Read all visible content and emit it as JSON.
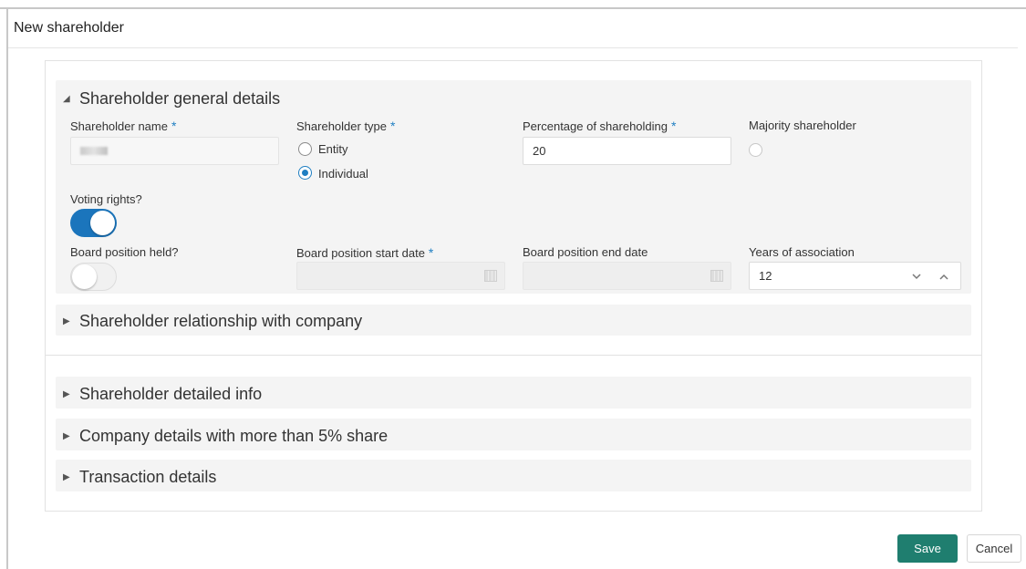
{
  "window": {
    "title": "New shareholder"
  },
  "general_details": {
    "heading": "Shareholder general details",
    "shareholder_name": {
      "label": "Shareholder name",
      "required_mark": "*"
    },
    "shareholder_type": {
      "label": "Shareholder type",
      "required_mark": "*",
      "options": [
        "Entity",
        "Individual"
      ],
      "selected": "Individual"
    },
    "percentage": {
      "label": "Percentage of shareholding",
      "required_mark": "*",
      "value": "20"
    },
    "majority": {
      "label": "Majority shareholder"
    },
    "voting_rights": {
      "label": "Voting rights?",
      "on": true
    },
    "board_position_held": {
      "label": "Board position held?",
      "on": false
    },
    "board_start": {
      "label": "Board position start date",
      "required_mark": "*"
    },
    "board_end": {
      "label": "Board position end date"
    },
    "years_association": {
      "label": "Years of association",
      "value": "12"
    }
  },
  "sections": {
    "relationship": "Shareholder relationship with company",
    "detailed_info": "Shareholder detailed info",
    "company_details": "Company details with more than 5% share",
    "transaction": "Transaction details"
  },
  "actions": {
    "save": "Save",
    "cancel": "Cancel"
  },
  "colors": {
    "accent": "#1b75bc",
    "save_button": "#1f7e6f",
    "required": "#1f7fc2"
  }
}
